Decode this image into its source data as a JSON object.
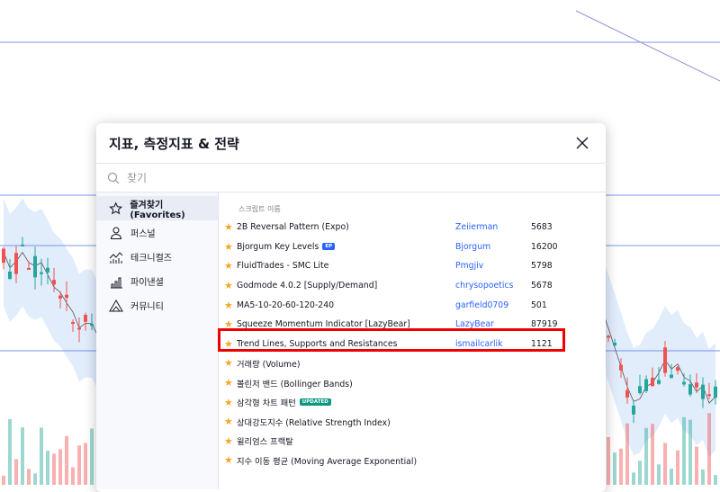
{
  "dialog": {
    "title": "지표, 측정지표 & 전략",
    "search_placeholder": "찾기",
    "column_header": "스크립트 이름",
    "sidebar": [
      {
        "label": "즐겨찾기 (Favorites)",
        "icon": "star-icon",
        "active": true
      },
      {
        "label": "퍼스널",
        "icon": "user-icon"
      },
      {
        "label": "테크니컬즈",
        "icon": "technicals-icon"
      },
      {
        "label": "파이낸셜",
        "icon": "financials-icon"
      },
      {
        "label": "커뮤니티",
        "icon": "community-icon"
      }
    ],
    "rows": [
      {
        "name": "2B Reversal Pattern (Expo)",
        "author": "Zeiierman",
        "count": "5683"
      },
      {
        "name": "Bjorgum Key Levels",
        "badge": "EP",
        "badge_color": "#2962ff",
        "author": "Bjorgum",
        "count": "16200"
      },
      {
        "name": "FluidTrades - SMC Lite",
        "author": "Pmgjiv",
        "count": "5798"
      },
      {
        "name": "Godmode 4.0.2 [Supply/Demand]",
        "author": "chrysopoetics",
        "count": "5678"
      },
      {
        "name": "MA5-10-20-60-120-240",
        "author": "garfield0709",
        "count": "501"
      },
      {
        "name": "Squeeze Momentum Indicator [LazyBear]",
        "author": "LazyBear",
        "count": "87919"
      },
      {
        "name": "Trend Lines, Supports and Resistances",
        "author": "ismailcarlik",
        "count": "1121",
        "highlighted": true
      },
      {
        "name": "거래량 (Volume)"
      },
      {
        "name": "볼린저 밴드 (Bollinger Bands)"
      },
      {
        "name": "삼각형 차트 패턴",
        "badge": "UPDATED",
        "badge_color": "#089981"
      },
      {
        "name": "상대강도지수 (Relative Strength Index)"
      },
      {
        "name": "윌리엄스 프랙탈"
      },
      {
        "name": "지수 이동 평균 (Moving Average Exponential)"
      }
    ]
  },
  "colors": {
    "up": "#26a69a",
    "down": "#ef5350",
    "line": "#5b7cf0",
    "band": "#d6e6fb",
    "star": "#f5a623",
    "link": "#2962ff",
    "highlight": "#ee0000"
  }
}
